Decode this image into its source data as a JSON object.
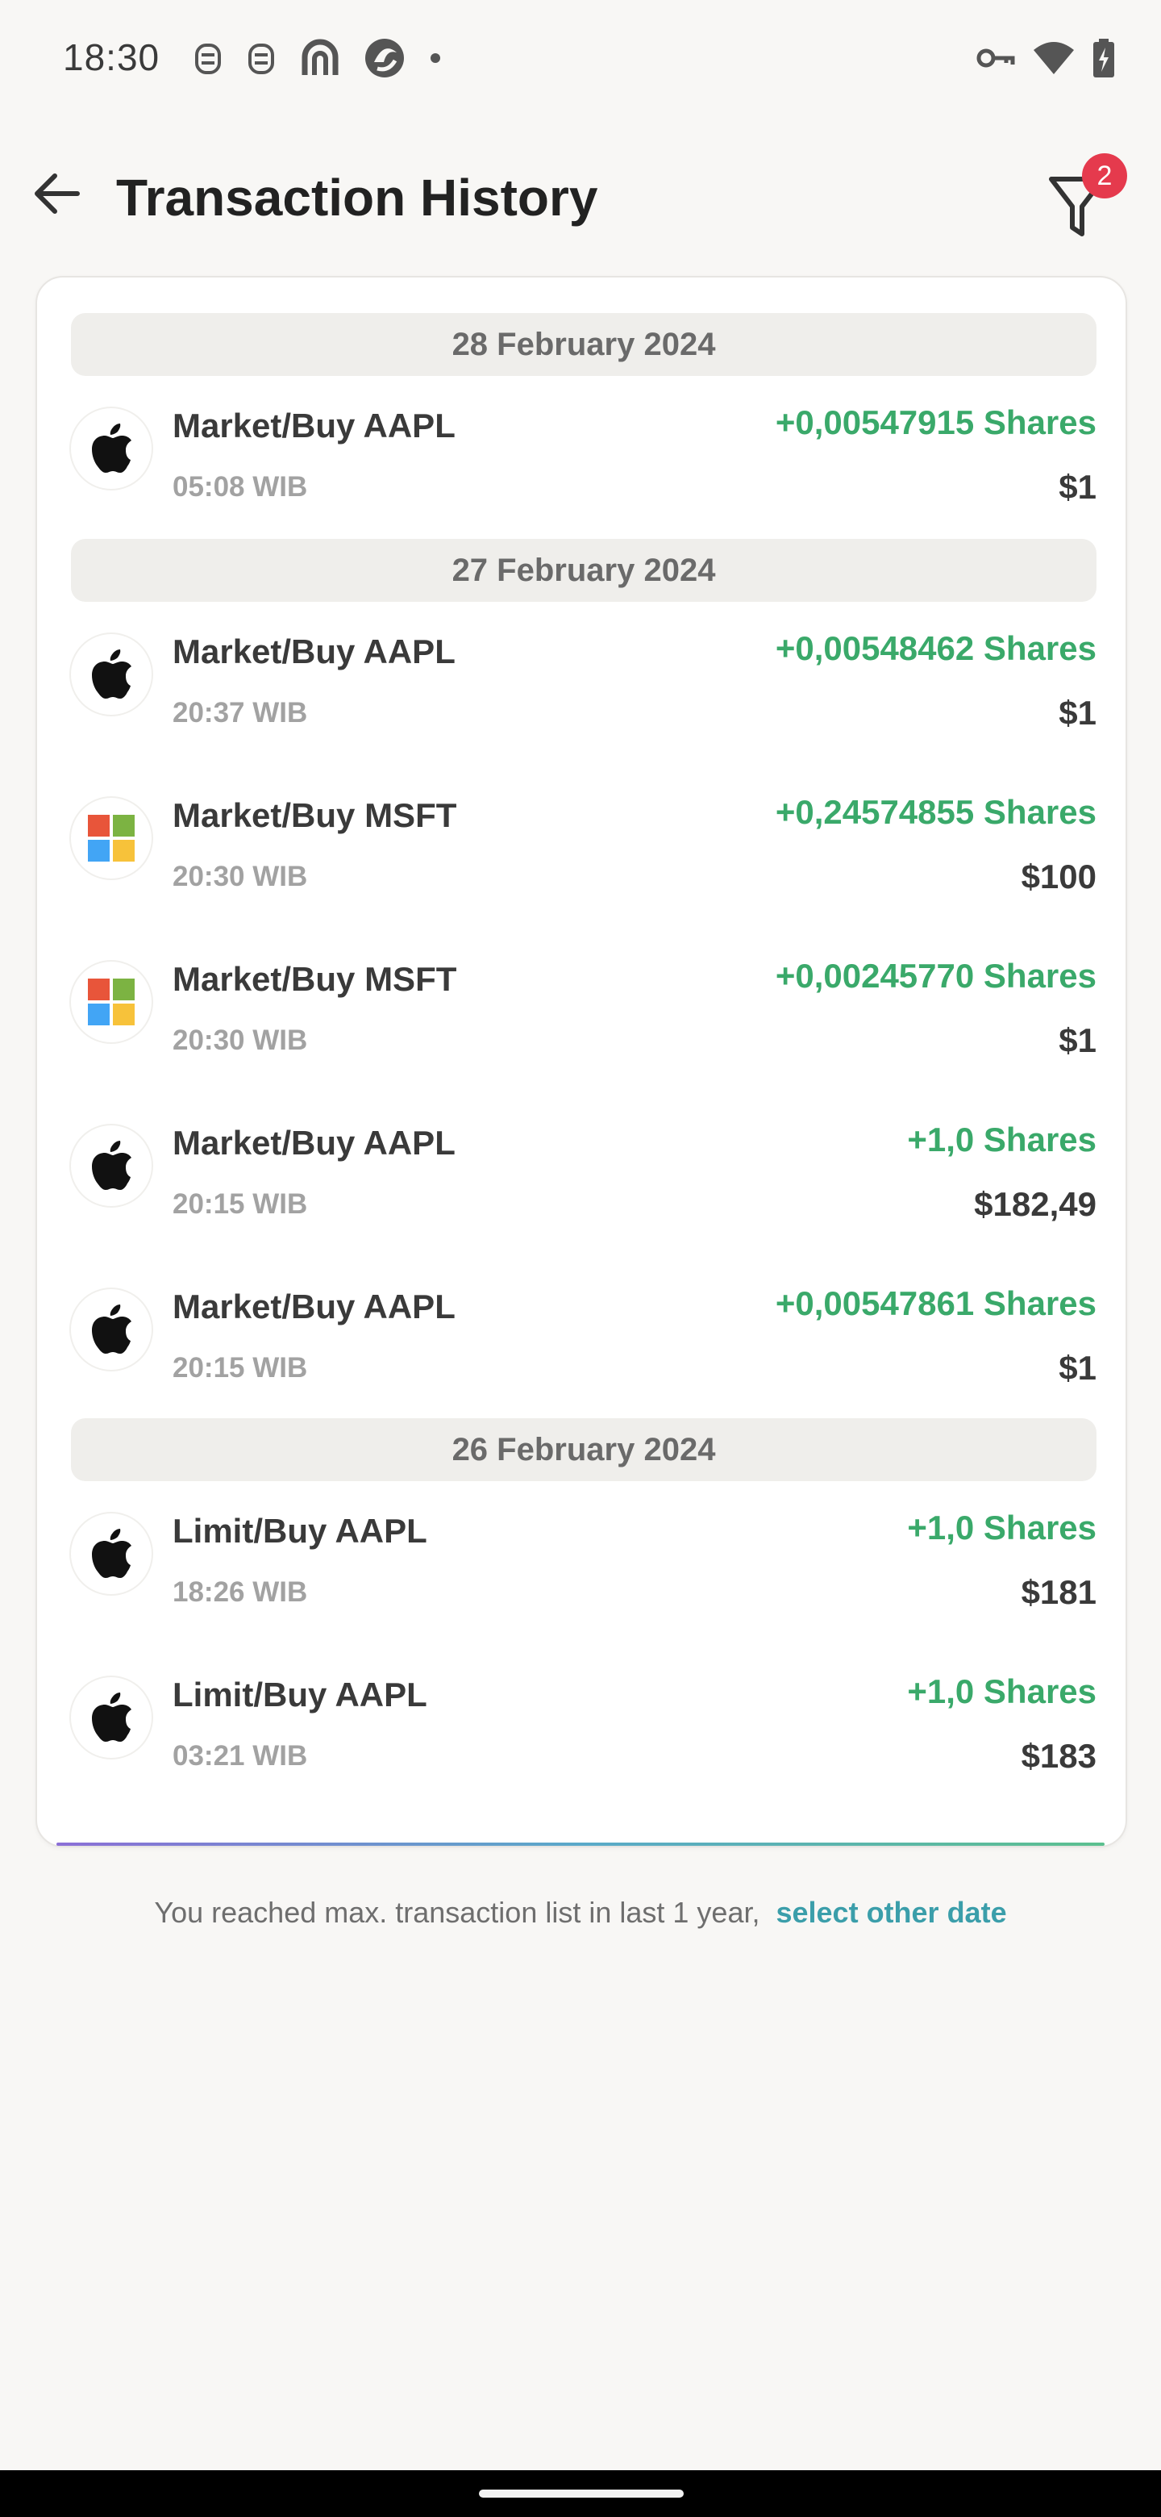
{
  "status_bar": {
    "time": "18:30",
    "left_icons": [
      "notification-icon",
      "notification-icon",
      "app-icon",
      "app-icon",
      "dot-icon"
    ],
    "right_icons": [
      "key-icon",
      "wifi-icon",
      "battery-icon"
    ]
  },
  "header": {
    "title": "Transaction History",
    "filter_badge_count": "2"
  },
  "groups": [
    {
      "date": "28 February 2024",
      "transactions": [
        {
          "title": "Market/Buy AAPL",
          "time": "05:08 WIB",
          "shares": "+0,00547915 Shares",
          "amount": "$1",
          "logo": "apple-logo-icon"
        }
      ]
    },
    {
      "date": "27 February 2024",
      "transactions": [
        {
          "title": "Market/Buy AAPL",
          "time": "20:37 WIB",
          "shares": "+0,00548462 Shares",
          "amount": "$1",
          "logo": "apple-logo-icon"
        },
        {
          "title": "Market/Buy MSFT",
          "time": "20:30 WIB",
          "shares": "+0,24574855 Shares",
          "amount": "$100",
          "logo": "microsoft-logo-icon"
        },
        {
          "title": "Market/Buy MSFT",
          "time": "20:30 WIB",
          "shares": "+0,00245770 Shares",
          "amount": "$1",
          "logo": "microsoft-logo-icon"
        },
        {
          "title": "Market/Buy AAPL",
          "time": "20:15 WIB",
          "shares": "+1,0 Shares",
          "amount": "$182,49",
          "logo": "apple-logo-icon"
        },
        {
          "title": "Market/Buy AAPL",
          "time": "20:15 WIB",
          "shares": "+0,00547861 Shares",
          "amount": "$1",
          "logo": "apple-logo-icon"
        }
      ]
    },
    {
      "date": "26 February 2024",
      "transactions": [
        {
          "title": "Limit/Buy AAPL",
          "time": "18:26 WIB",
          "shares": "+1,0 Shares",
          "amount": "$181",
          "logo": "apple-logo-icon"
        },
        {
          "title": "Limit/Buy AAPL",
          "time": "03:21 WIB",
          "shares": "+1,0 Shares",
          "amount": "$183",
          "logo": "apple-logo-icon"
        }
      ]
    }
  ],
  "footer": {
    "note": "You reached max. transaction list in last 1 year,",
    "link": "select other date"
  },
  "colors": {
    "positive": "#3aa96a",
    "link": "#3b9eaa",
    "badge": "#e53a4d"
  }
}
